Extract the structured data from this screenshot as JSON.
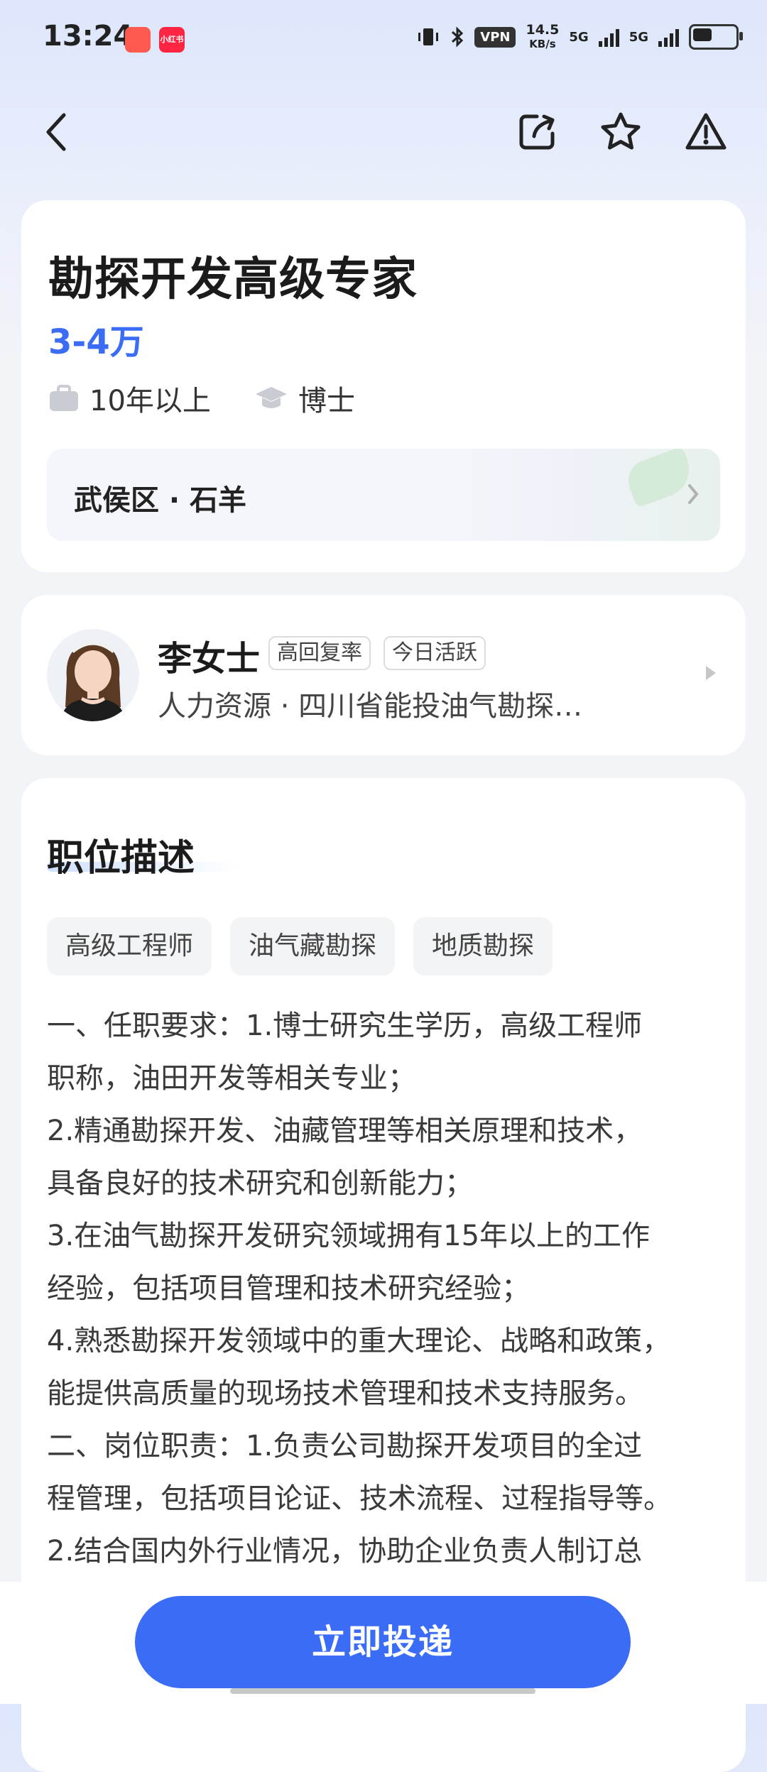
{
  "status_bar": {
    "time": "13:24",
    "badge2_text": "小红书",
    "vpn": "VPN",
    "speed_value": "14.5",
    "speed_unit": "KB/s",
    "net1": "5G",
    "net2": "5G"
  },
  "nav": {
    "back_icon": "chevron-left-icon",
    "share_icon": "share-icon",
    "favorite_icon": "star-icon",
    "report_icon": "warning-icon"
  },
  "job": {
    "title": "勘探开发高级专家",
    "salary": "3-4万",
    "experience": "10年以上",
    "education": "博士",
    "location": "武侯区 · 石羊"
  },
  "recruiter": {
    "name": "李女士",
    "tag1": "高回复率",
    "tag2": "今日活跃",
    "subtitle": "人力资源 · 四川省能投油气勘探…"
  },
  "description": {
    "section_title": "职位描述",
    "tags": [
      "高级工程师",
      "油气藏勘探",
      "地质勘探"
    ],
    "lines": [
      "一、任职要求：1.博士研究生学历，高级工程师",
      "职称，油田开发等相关专业；",
      "2.精通勘探开发、油藏管理等相关原理和技术，",
      "具备良好的技术研究和创新能力；",
      "3.在油气勘探开发研究领域拥有15年以上的工作",
      "经验，包括项目管理和技术研究经验；",
      "4.熟悉勘探开发领域中的重大理论、战略和政策，",
      "能提供高质量的现场技术管理和技术支持服务。",
      "二、岗位职责：1.负责公司勘探开发项目的全过",
      "程管理，包括项目论证、技术流程、过程指导等。",
      "2.结合国内外行业情况，协助企业负责人制订总"
    ]
  },
  "footer": {
    "apply_label": "立即投递"
  },
  "colors": {
    "accent": "#3b6cf6"
  }
}
